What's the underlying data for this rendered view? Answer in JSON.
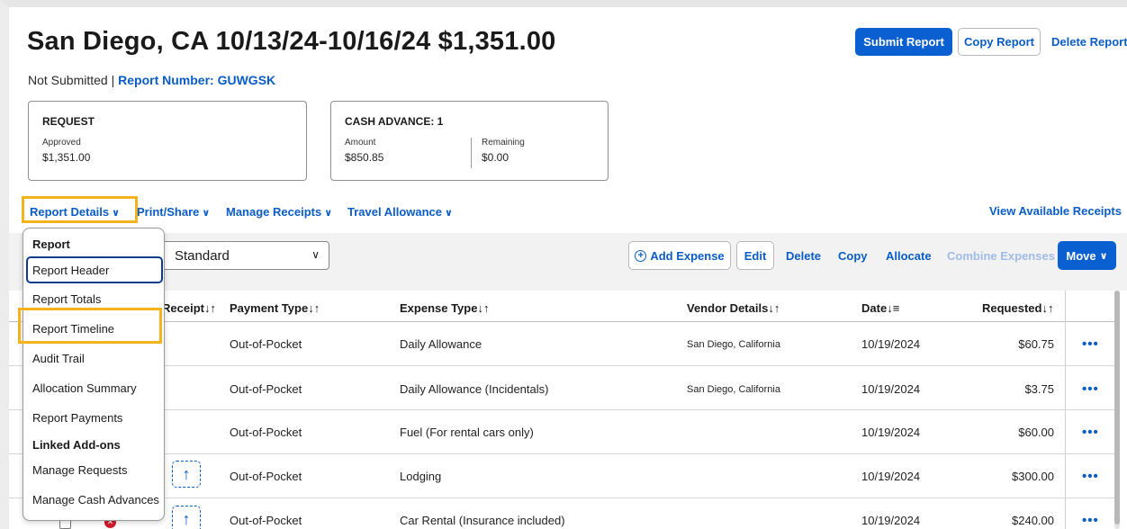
{
  "report": {
    "title": "San Diego, CA 10/13/24-10/16/24 $1,351.00",
    "status": "Not Submitted",
    "status_sep": "|",
    "report_number_label": "Report Number: GUWGSK"
  },
  "header_actions": {
    "submit": "Submit Report",
    "copy": "Copy Report",
    "delete": "Delete Report"
  },
  "cards": {
    "request": {
      "title": "REQUEST",
      "approved_label": "Approved",
      "approved_value": "$1,351.00"
    },
    "cash_advance": {
      "title": "CASH ADVANCE: 1",
      "amount_label": "Amount",
      "amount_value": "$850.85",
      "remaining_label": "Remaining",
      "remaining_value": "$0.00"
    }
  },
  "menu": {
    "report_details": "Report Details",
    "print_share": "Print/Share",
    "manage_receipts": "Manage Receipts",
    "travel_allowance": "Travel Allowance",
    "view_receipts": "View Available Receipts"
  },
  "view_select": {
    "value": "Standard"
  },
  "toolbar": {
    "add_expense": "Add Expense",
    "edit": "Edit",
    "delete": "Delete",
    "copy": "Copy",
    "allocate": "Allocate",
    "combine": "Combine Expenses",
    "move": "Move"
  },
  "columns": {
    "receipt": "Receipt",
    "payment_type": "Payment Type",
    "expense_type": "Expense Type",
    "vendor": "Vendor Details",
    "date": "Date",
    "requested": "Requested"
  },
  "rows": [
    {
      "payment": "Out-of-Pocket",
      "expense": "Daily Allowance",
      "vendor": "San Diego, California",
      "date": "10/19/2024",
      "amount": "$60.75"
    },
    {
      "payment": "Out-of-Pocket",
      "expense": "Daily Allowance (Incidentals)",
      "vendor": "San Diego, California",
      "date": "10/19/2024",
      "amount": "$3.75"
    },
    {
      "payment": "Out-of-Pocket",
      "expense": "Fuel (For rental cars only)",
      "vendor": "",
      "date": "10/19/2024",
      "amount": "$60.00"
    },
    {
      "payment": "Out-of-Pocket",
      "expense": "Lodging",
      "vendor": "",
      "date": "10/19/2024",
      "amount": "$300.00"
    },
    {
      "payment": "Out-of-Pocket",
      "expense": "Car Rental (Insurance included)",
      "vendor": "",
      "date": "10/19/2024",
      "amount": "$240.00"
    }
  ],
  "dropdown": {
    "section_report": "Report",
    "items": [
      "Report Header",
      "Report Totals",
      "Report Timeline",
      "Audit Trail",
      "Allocation Summary",
      "Report Payments"
    ],
    "section_addons": "Linked Add-ons",
    "addon_items": [
      "Manage Requests",
      "Manage Cash Advances"
    ]
  },
  "colors": {
    "accent": "#0a5fd1",
    "link": "#0a5cc7",
    "highlight": "#f5b21b",
    "error": "#d11a2a"
  }
}
